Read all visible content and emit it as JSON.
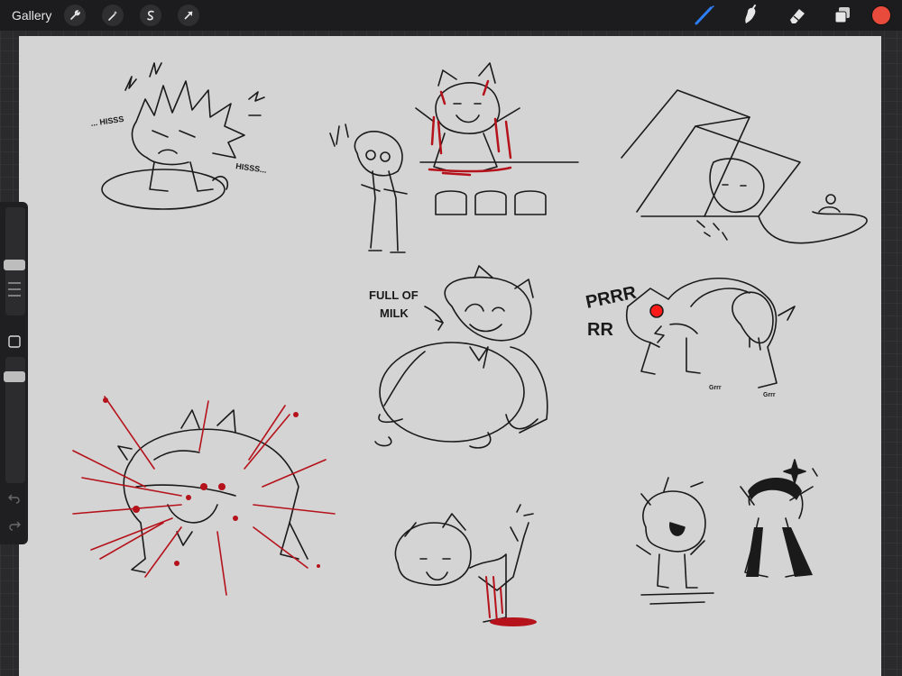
{
  "toolbar": {
    "gallery_label": "Gallery",
    "left_tools": [
      "wrench-icon",
      "magic-wand-icon",
      "selection-s-icon",
      "transform-arrow-icon"
    ],
    "right_tools": [
      "brush-icon",
      "smudge-icon",
      "eraser-icon",
      "layers-icon"
    ],
    "active_tool": "brush-icon",
    "accent_color": "#2d7ff9",
    "current_color": "#e84a3b"
  },
  "sidebar": {
    "brush_size_level": 0.2,
    "opacity_level": 0.15,
    "buttons": [
      "modify-button",
      "undo-icon",
      "redo-icon"
    ]
  },
  "canvas": {
    "background_color": "#d4d4d4",
    "ink_color": "#1a1a1a",
    "blood_color": "#b5121b",
    "eye_color": "#ff1a1a",
    "texts": {
      "hiss1": "... HISSS",
      "hiss2": "HISSS...",
      "full_of_milk_1": "FULL OF",
      "full_of_milk_2": "MILK",
      "prrr": "PRRR",
      "rr": "RR",
      "grrr1": "Grrr",
      "grrr2": "Grrr"
    }
  }
}
